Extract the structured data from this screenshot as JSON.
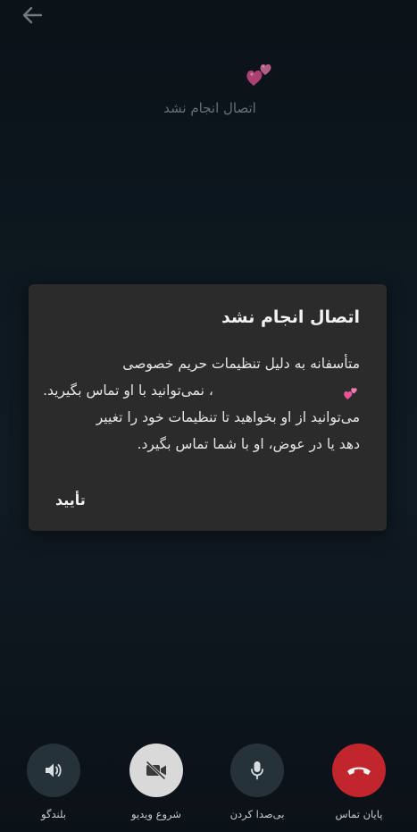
{
  "caller": {
    "status": "اتصال انجام نشد",
    "avatar_emoji": "pink-hearts-emoji"
  },
  "dialog": {
    "title": "اتصال انجام نشد",
    "line1": "متأسفانه به دلیل تنظیمات حریم خصوصی",
    "line2": "، نمی‌توانید با او تماس بگیرید.",
    "line3": "می‌توانید از او بخواهید تا تنظیمات خود را تغییر",
    "line4": "دهد یا در عوض، او با شما تماس بگیرد.",
    "ok_label": "تأیید"
  },
  "controls": {
    "speaker_label": "بلندگو",
    "video_label": "شروع ویدیو",
    "mute_label": "بی‌صدا کردن",
    "end_label": "پایان تماس"
  },
  "colors": {
    "end_call": "#c0262b",
    "dialog_bg": "#2b2b2b",
    "video_button": "#d9d9d9",
    "background": "#13222d"
  }
}
